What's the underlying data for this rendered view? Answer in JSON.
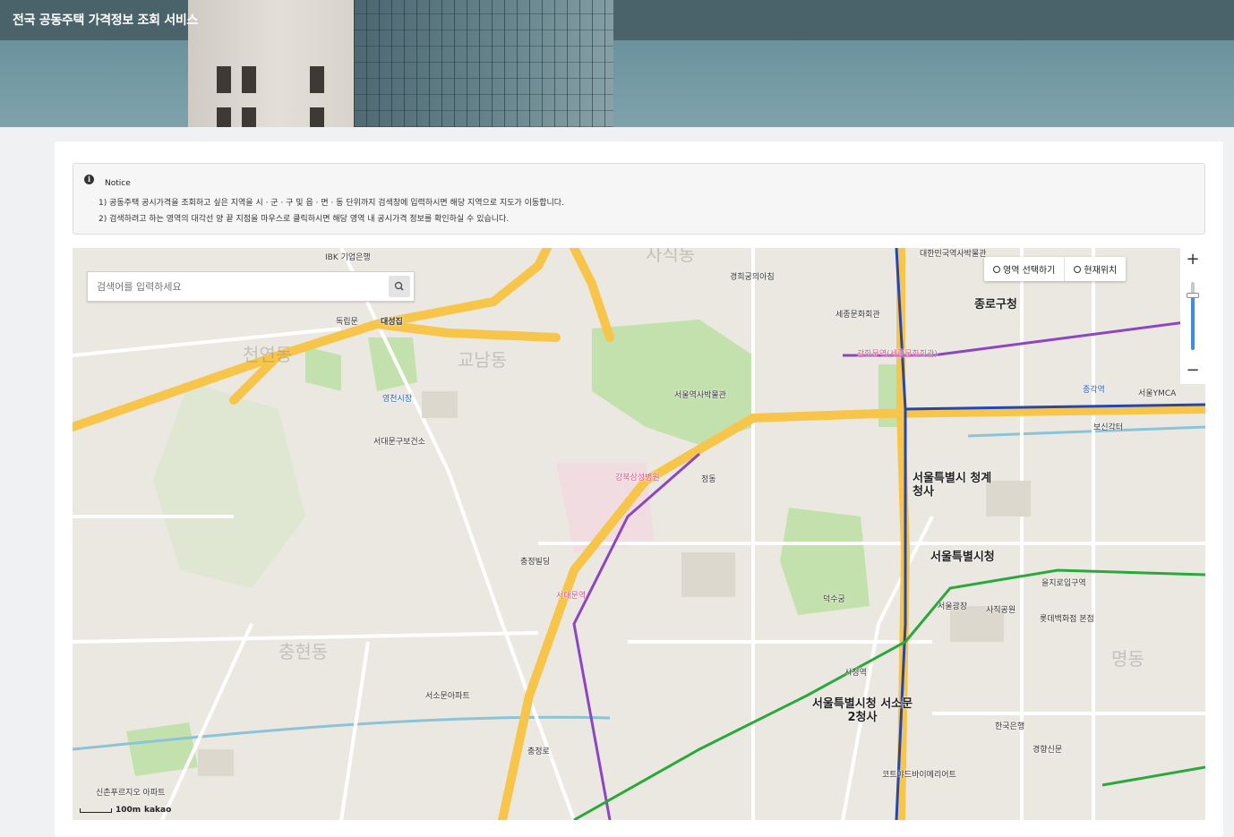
{
  "header": {
    "title": "전국 공동주택 가격정보 조회 서비스"
  },
  "notice": {
    "title": "Notice",
    "lines": [
      "1) 공동주택 공시가격을 조회하고 싶은 지역을 시 · 군 · 구 및 읍 · 면 · 동 단위까지 검색창에 입력하시면 해당 지역으로 지도가 이동합니다.",
      "2) 검색하려고 하는 영역의 대각선 양 끝 지점을 마우스로 클릭하시면 해당 영역 내 공시가격 정보를 확인하실 수 있습니다."
    ]
  },
  "map": {
    "search_placeholder": "검색어를 입력하세요",
    "tools": {
      "area_select": "영역 선택하기",
      "current_location": "현재위치"
    },
    "zoom": {
      "in": "+",
      "out": "−",
      "level_fraction": 0.8
    },
    "scale": {
      "distance": "100m",
      "provider": "kakao"
    },
    "colors": {
      "road_major": "#f6c54a",
      "park": "#bfe0a8",
      "line_purple": "#8b45c6",
      "line_blue": "#2346b5",
      "line_green": "#29a83c",
      "water": "#8bc3d8"
    },
    "districts": [
      "사직동",
      "천연동",
      "교남동",
      "충현동",
      "명동"
    ],
    "big_labels": [
      "서울특별시청",
      "서울특별시청 서소문2청사",
      "서울특별시 청계청사",
      "종로구청"
    ],
    "places": [
      "독립문",
      "대성집",
      "IBK 기업은행",
      "서대문구보건소",
      "영천시장",
      "신촌푸르지오 아파트",
      "경희궁의아침",
      "정동",
      "충정빌딩",
      "덕수궁",
      "세종문화회관",
      "광화문역(세종문화회관)",
      "시청역",
      "을지로입구역",
      "종각역",
      "서대문역",
      "대한민국역사박물관",
      "서울역사박물관",
      "강북삼성병원",
      "사직공원",
      "롯데백화점 본점",
      "한국은행",
      "코트야드바이메리어트",
      "서울광장",
      "서소문아파트",
      "충정로",
      "경향신문",
      "서울YMCA",
      "보신각터"
    ]
  }
}
